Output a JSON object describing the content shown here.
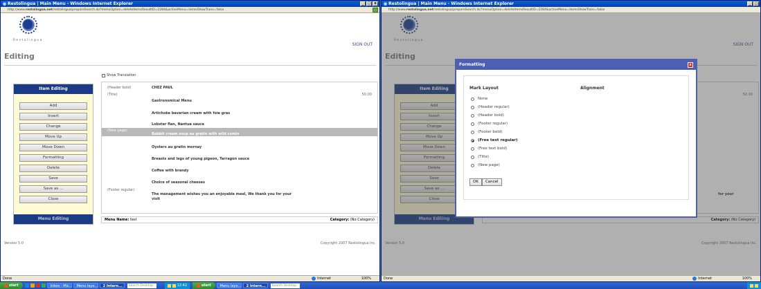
{
  "windows": [
    {
      "title": "Restolingua | Main Menu - Windows Internet Explorer",
      "address_prefix": "http://www.",
      "address_domain": "restolingua.net",
      "address_path": "/restolingua/prepareSearch.do?menuOption=deleteItemsResultID=2284&activeMenu=itemsShowTrans=false"
    },
    {
      "title": "Restolingua | Main Menu - Windows Internet Explorer",
      "address_prefix": "http://www.",
      "address_domain": "restolingua.net",
      "address_path": "/restolingua/prepareSearch.do?menuOption=deleteItemsResultID=2284&activeMenu=itemsShowTrans=false"
    }
  ],
  "app": {
    "logo_text": "Restolingua",
    "signout": "SIGN OUT",
    "page_title": "Editing",
    "show_translation": "Show Translation",
    "version": "Version 5.0",
    "copyright": "Copyright 2007 Restolingua Inc."
  },
  "sidebar": {
    "head": "Item Editing",
    "foot": "Menu Editing",
    "buttons": [
      "Add",
      "Insert",
      "Change",
      "Move Up",
      "Move Down",
      "Formatting",
      "Delete",
      "Save",
      "Save as ...",
      "Close"
    ]
  },
  "menu_rows": [
    {
      "mark": "(Header bold)",
      "text": "CHEZ PAUL",
      "price": ""
    },
    {
      "mark": "(Title)",
      "text": "Gastronomical Menu",
      "price": "50.00"
    },
    {
      "mark": "",
      "text": "Artichoke bavarian cream with foie gras",
      "price": ""
    },
    {
      "mark": "",
      "text": "Lobster flan, Nantua sauce",
      "price": ""
    },
    {
      "mark": "(New page)",
      "text": "Rabbit cream soup au gratin with wild cumin",
      "price": ""
    },
    {
      "mark": "",
      "text": "Oysters au gratin mornay",
      "price": ""
    },
    {
      "mark": "",
      "text": "Breasts and legs of young pigeon, Tarragon sauce",
      "price": ""
    },
    {
      "mark": "",
      "text": "Coffee with brandy",
      "price": ""
    },
    {
      "mark": "",
      "text": "Choice of seasonal cheeses",
      "price": ""
    },
    {
      "mark": "(Footer regular)",
      "text": "The management wishes you an enjoyable meal, We thank you for your",
      "price": ""
    },
    {
      "mark": "",
      "text": "visit",
      "price": ""
    }
  ],
  "menubar": {
    "name_label": "Menu Name:",
    "name_value": "test",
    "category_label": "Category:",
    "category_value": "(No Category)"
  },
  "right_partial": {
    "price": "50.00",
    "footer_fragment": "for your",
    "category_label": "Category:",
    "category_value": "(No Category)"
  },
  "dialog": {
    "title": "Formatting",
    "mark_layout": "Mark Layout",
    "alignment": "Alignment",
    "options": [
      "None",
      "(Header regular)",
      "(Header bold)",
      "(Footer regular)",
      "(Footer bold)",
      "(Free text regular)",
      "(Free text bold)",
      "(Title)",
      "(New page)"
    ],
    "selected_option": "(Free text regular)",
    "ok": "OK",
    "cancel": "Cancel"
  },
  "statusbar": {
    "left": "Done",
    "zone": "Internet",
    "zoom": "100%"
  },
  "taskbar": {
    "start": "start",
    "tasks": [
      "Inbox - Mic...",
      "Menu layo...",
      "2 Intern...",
      "Menu layo...",
      "2 Intern..."
    ],
    "search": "Search Desktop",
    "clock": "12:42"
  },
  "colors": {
    "sidebar_head": "#1b3b84",
    "sidebar_bg": "#fffbd5",
    "dialog_title": "#4d5fb2",
    "selected_row": "#b8b8b8"
  }
}
